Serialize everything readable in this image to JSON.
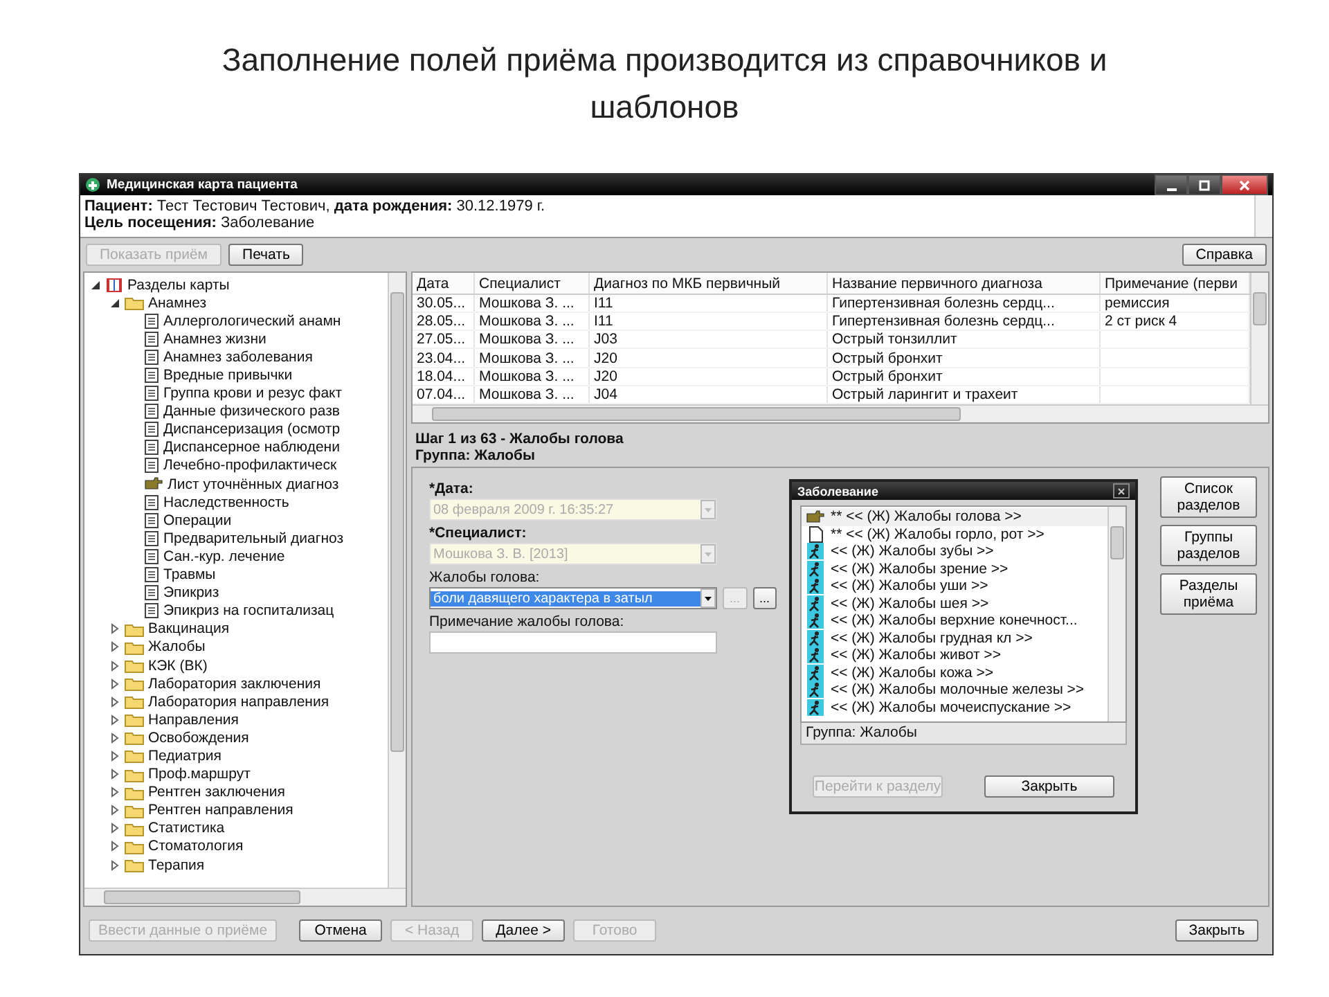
{
  "slide_title": "Заполнение полей приёма производится из справочников и шаблонов",
  "window": {
    "title": "Медицинская карта пациента"
  },
  "patient_info": [
    "**Пациент:** Тест Тестович Тестович,  **дата рождения:** 30.12.1979 г.",
    "**Цель посещения:** Заболевание"
  ],
  "toolbar": [
    {
      "label": "Показать приём",
      "disabled": true
    },
    {
      "label": "Печать",
      "disabled": false
    }
  ],
  "help_button": {
    "label": "Справка",
    "disabled": false
  },
  "tree": [
    {
      "label": "Разделы карты",
      "kind": "book",
      "expanded": true,
      "children": [
        {
          "label": "Анамнез",
          "kind": "folder",
          "expanded": true,
          "children": [
            {
              "label": "Аллергологический анамн",
              "kind": "doc"
            },
            {
              "label": "Анамнез жизни",
              "kind": "doc"
            },
            {
              "label": "Анамнез заболевания",
              "kind": "doc"
            },
            {
              "label": "Вредные привычки",
              "kind": "doc"
            },
            {
              "label": "Группа крови и резус факт",
              "kind": "doc"
            },
            {
              "label": "Данные физического разв",
              "kind": "doc"
            },
            {
              "label": "Диспансеризация (осмотр",
              "kind": "doc"
            },
            {
              "label": "Диспансерное наблюдени",
              "kind": "doc"
            },
            {
              "label": "Лечебно-профилактическ",
              "kind": "doc"
            },
            {
              "label": "Лист уточнённых диагноз",
              "kind": "pointer"
            },
            {
              "label": "Наследственность",
              "kind": "doc"
            },
            {
              "label": "Операции",
              "kind": "doc"
            },
            {
              "label": "Предварительный диагноз",
              "kind": "doc"
            },
            {
              "label": "Сан.-кур. лечение",
              "kind": "doc"
            },
            {
              "label": "Травмы",
              "kind": "doc"
            },
            {
              "label": "Эпикриз",
              "kind": "doc"
            },
            {
              "label": "Эпикриз на госпитализац",
              "kind": "doc"
            }
          ]
        },
        {
          "label": "Вакцинация",
          "kind": "folder",
          "expanded": false
        },
        {
          "label": "Жалобы",
          "kind": "folder",
          "expanded": false
        },
        {
          "label": "КЭК (ВК)",
          "kind": "folder",
          "expanded": false
        },
        {
          "label": "Лаборатория заключения",
          "kind": "folder",
          "expanded": false
        },
        {
          "label": "Лаборатория направления",
          "kind": "folder",
          "expanded": false
        },
        {
          "label": "Направления",
          "kind": "folder",
          "expanded": false
        },
        {
          "label": "Освобождения",
          "kind": "folder",
          "expanded": false
        },
        {
          "label": "Педиатрия",
          "kind": "folder",
          "expanded": false
        },
        {
          "label": "Проф.маршрут",
          "kind": "folder",
          "expanded": false
        },
        {
          "label": "Рентген заключения",
          "kind": "folder",
          "expanded": false
        },
        {
          "label": "Рентген направления",
          "kind": "folder",
          "expanded": false
        },
        {
          "label": "Статистика",
          "kind": "folder",
          "expanded": false
        },
        {
          "label": "Стоматология",
          "kind": "folder",
          "expanded": false
        },
        {
          "label": "Терапия",
          "kind": "folder",
          "expanded": false
        }
      ]
    }
  ],
  "table": {
    "columns": [
      "Дата",
      "Специалист",
      "Диагноз по МКБ первичный",
      "Название первичного диагноза",
      "Примечание (перви"
    ],
    "rows": [
      [
        "30.05...",
        "Мошкова З. ...",
        "I11",
        "Гипертензивная болезнь сердц...",
        "ремиссия"
      ],
      [
        "28.05...",
        "Мошкова З. ...",
        "I11",
        "Гипертензивная болезнь сердц...",
        "2 ст риск 4"
      ],
      [
        "27.05...",
        "Мошкова З. ...",
        "J03",
        "Острый тонзиллит",
        ""
      ],
      [
        "23.04...",
        "Мошкова З. ...",
        "J20",
        "Острый бронхит",
        ""
      ],
      [
        "18.04...",
        "Мошкова З. ...",
        "J20",
        "Острый бронхит",
        ""
      ],
      [
        "07.04...",
        "Мошкова З. ...",
        "J04",
        "Острый ларингит и трахеит",
        ""
      ]
    ]
  },
  "step": {
    "title": "Шаг 1 из 63 - Жалобы голова",
    "group": "Группа: Жалобы"
  },
  "fields": [
    {
      "label": "*Дата:",
      "required": true,
      "kind": "combo",
      "disabled": true,
      "highlighted": false,
      "value": "08 февраля 2009 г.   16:35:27"
    },
    {
      "label": "*Специалист:",
      "required": true,
      "kind": "combo",
      "disabled": true,
      "highlighted": false,
      "value": "Мошкова З. В.  [2013]"
    },
    {
      "label": "Жалобы голова:",
      "required": false,
      "kind": "combo",
      "disabled": false,
      "highlighted": true,
      "value": "боли давящего характера в затыл",
      "extra_buttons": [
        {
          "label": "...",
          "disabled": true
        },
        {
          "label": "...",
          "disabled": false
        }
      ]
    },
    {
      "label": "Примечание жалобы голова:",
      "required": false,
      "kind": "text"
    }
  ],
  "side_buttons": [
    "Список разделов",
    "Группы разделов",
    "Разделы приёма"
  ],
  "dialog": {
    "title": "Заболевание",
    "items": [
      {
        "label": "** << (Ж) Жалобы голова >>",
        "kind": "pointer",
        "selected": true
      },
      {
        "label": "** << (Ж) Жалобы горло, рот >>",
        "kind": "blank",
        "selected": false
      },
      {
        "label": "<< (Ж) Жалобы зубы >>",
        "kind": "person",
        "selected": false
      },
      {
        "label": "<< (Ж) Жалобы зрение >>",
        "kind": "person",
        "selected": false
      },
      {
        "label": "<< (Ж) Жалобы уши >>",
        "kind": "person",
        "selected": false
      },
      {
        "label": "<< (Ж) Жалобы шея >>",
        "kind": "person",
        "selected": false
      },
      {
        "label": "<< (Ж) Жалобы верхние конечност...",
        "kind": "person",
        "selected": false
      },
      {
        "label": "<< (Ж) Жалобы грудная кл >>",
        "kind": "person",
        "selected": false
      },
      {
        "label": "<< (Ж) Жалобы живот >>",
        "kind": "person",
        "selected": false
      },
      {
        "label": "<< (Ж) Жалобы кожа >>",
        "kind": "person",
        "selected": false
      },
      {
        "label": "<< (Ж) Жалобы молочные железы >>",
        "kind": "person",
        "selected": false
      },
      {
        "label": "<< (Ж) Жалобы мочеиспускание >>",
        "kind": "person",
        "selected": false
      }
    ],
    "group": "Группа: Жалобы",
    "buttons": [
      {
        "label": "Перейти к разделу",
        "disabled": true
      },
      {
        "label": "Закрыть",
        "disabled": false
      }
    ]
  },
  "bottom_buttons": [
    {
      "label": "Ввести данные о приёме",
      "disabled": true
    },
    {
      "label": "Отмена",
      "disabled": false
    },
    {
      "label": "< Назад",
      "disabled": true
    },
    {
      "label": "Далее >",
      "disabled": false
    },
    {
      "label": "Готово",
      "disabled": true
    }
  ],
  "close_button": {
    "label": "Закрыть",
    "disabled": false
  }
}
